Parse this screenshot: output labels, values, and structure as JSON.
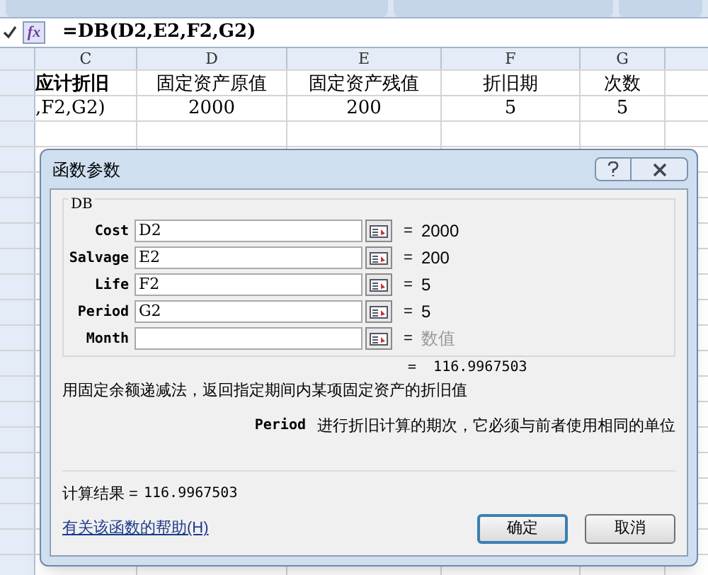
{
  "formula_bar": {
    "function_button": "fx",
    "formula": "=DB(D2,E2,F2,G2)"
  },
  "sheet": {
    "columns": [
      "C",
      "D",
      "E",
      "F",
      "G"
    ],
    "rows": [
      [
        "应计折旧",
        "固定资产原值",
        "固定资产残值",
        "折旧期",
        "次数"
      ],
      [
        ",F2,G2)",
        "2000",
        "200",
        "5",
        "5"
      ]
    ]
  },
  "dialog": {
    "title": "函数参数",
    "function_name": "DB",
    "arguments": [
      {
        "label": "Cost",
        "value": "D2",
        "equals": "=",
        "result": "2000",
        "result_is_hint": false
      },
      {
        "label": "Salvage",
        "value": "E2",
        "equals": "=",
        "result": "200",
        "result_is_hint": false
      },
      {
        "label": "Life",
        "value": "F2",
        "equals": "=",
        "result": "5",
        "result_is_hint": false
      },
      {
        "label": "Period",
        "value": "G2",
        "equals": "=",
        "result": "5",
        "result_is_hint": false
      },
      {
        "label": "Month",
        "equals": "=",
        "result": "数值",
        "result_is_hint": true
      }
    ],
    "formula_result": "=  116.9967503",
    "description": "用固定余额递减法，返回指定期间内某项固定资产的折旧值",
    "argument_name": "Period",
    "argument_help": "进行折旧计算的期次，它必须与前者使用相同的单位",
    "result_label": "计算结果 =",
    "result_value": "116.9967503",
    "help_link": "有关该函数的帮助(H)",
    "buttons": [
      {
        "label": "确定",
        "default": true
      },
      {
        "label": "取消",
        "default": false
      }
    ]
  }
}
